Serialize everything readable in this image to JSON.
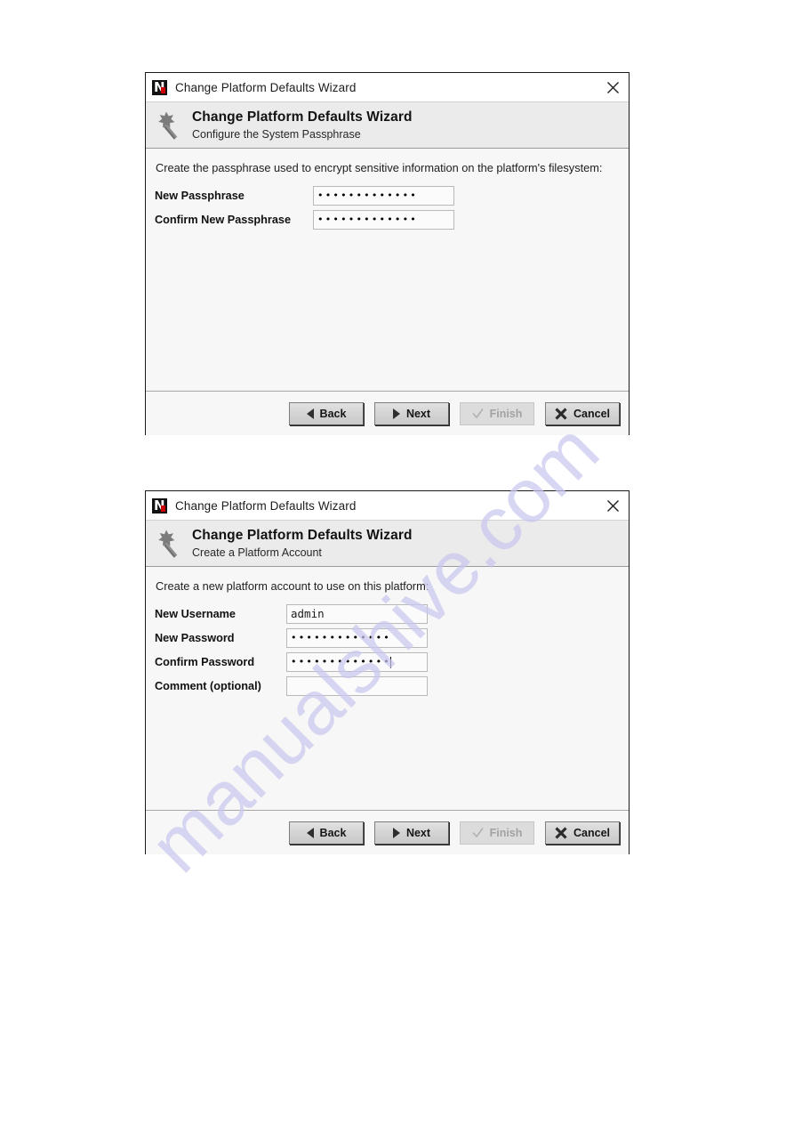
{
  "watermark": {
    "text": "manualshive.com"
  },
  "dialogs": [
    {
      "window_title": "Change Platform Defaults Wizard",
      "app_icon": "niagara-n-logo-icon",
      "close_icon": "close-icon",
      "banner": {
        "icon": "magic-wand-icon",
        "title": "Change Platform Defaults Wizard",
        "subtitle": "Configure the System Passphrase"
      },
      "intro": "Create the passphrase used to encrypt sensitive information on the platform's filesystem:",
      "fields": [
        {
          "label": "New Passphrase",
          "value": "•••••••••••••",
          "type": "password",
          "caret": false,
          "placeholder": ""
        },
        {
          "label": "Confirm New Passphrase",
          "value": "•••••••••••••",
          "type": "password",
          "caret": false,
          "placeholder": ""
        }
      ],
      "buttons": [
        {
          "label": "Back",
          "icon": "triangle-left-icon",
          "enabled": true
        },
        {
          "label": "Next",
          "icon": "triangle-right-icon",
          "enabled": true
        },
        {
          "label": "Finish",
          "icon": "checkmark-icon",
          "enabled": false
        },
        {
          "label": "Cancel",
          "icon": "x-mark-icon",
          "enabled": true
        }
      ]
    },
    {
      "window_title": "Change Platform Defaults Wizard",
      "app_icon": "niagara-n-logo-icon",
      "close_icon": "close-icon",
      "banner": {
        "icon": "magic-wand-icon",
        "title": "Change Platform Defaults Wizard",
        "subtitle": "Create a Platform Account"
      },
      "intro": "Create a new platform account to use on this platform:",
      "fields": [
        {
          "label": "New Username",
          "value": "admin",
          "type": "text",
          "caret": false,
          "placeholder": ""
        },
        {
          "label": "New Password",
          "value": "•••••••••••••",
          "type": "password",
          "caret": false,
          "placeholder": ""
        },
        {
          "label": "Confirm Password",
          "value": "•••••••••••••",
          "type": "password",
          "caret": true,
          "placeholder": ""
        },
        {
          "label": "Comment (optional)",
          "value": "",
          "type": "text",
          "caret": false,
          "placeholder": ""
        }
      ],
      "buttons": [
        {
          "label": "Back",
          "icon": "triangle-left-icon",
          "enabled": true
        },
        {
          "label": "Next",
          "icon": "triangle-right-icon",
          "enabled": true
        },
        {
          "label": "Finish",
          "icon": "checkmark-icon",
          "enabled": false
        },
        {
          "label": "Cancel",
          "icon": "x-mark-icon",
          "enabled": true
        }
      ]
    }
  ],
  "colors": {
    "banner_bg": "#ebebeb",
    "body_bg": "#f7f7f7",
    "accent_red": "#cc0000",
    "watermark": "#c9c7ef",
    "disabled_text": "#a2a2a2"
  }
}
